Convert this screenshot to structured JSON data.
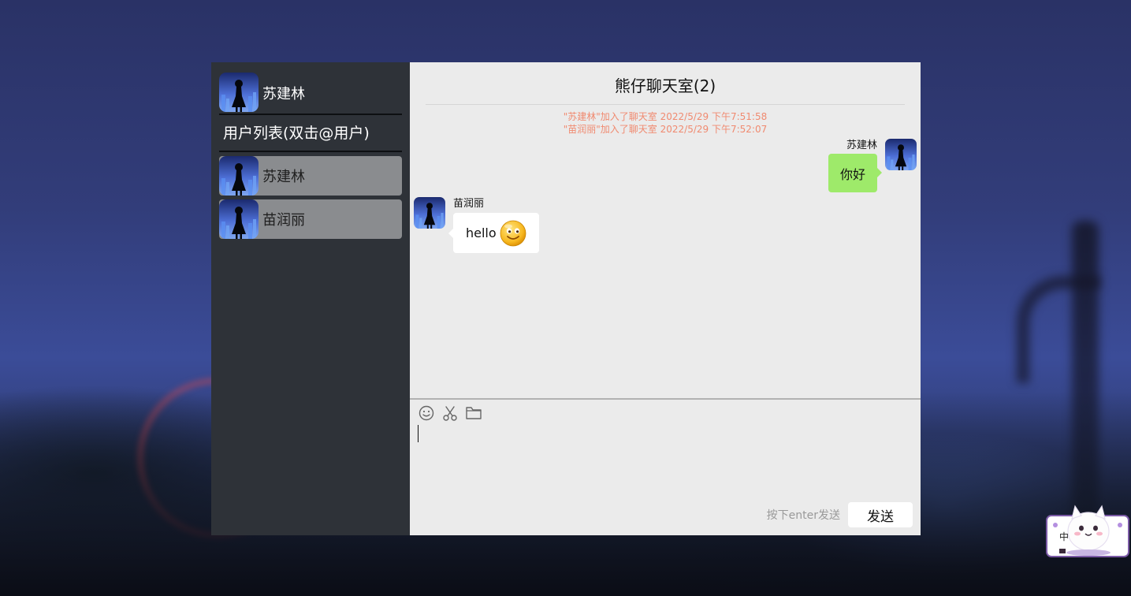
{
  "sidebar": {
    "current_user": {
      "name": "苏建林",
      "avatar_icon": "avatar-girl-silhouette-icon"
    },
    "list_title": "用户列表(双击@用户)",
    "users": [
      {
        "name": "苏建林",
        "avatar_icon": "avatar-girl-silhouette-icon"
      },
      {
        "name": "苗润丽",
        "avatar_icon": "avatar-girl-silhouette-icon"
      }
    ]
  },
  "chat": {
    "room_title": "熊仔聊天室(2)",
    "system_messages": [
      "\"苏建林\"加入了聊天室 2022/5/29 下午7:51:58",
      "\"苗润丽\"加入了聊天室 2022/5/29 下午7:52:07"
    ],
    "messages": [
      {
        "sender": "苏建林",
        "text": "你好",
        "side": "right",
        "bubble_color": "#9eea6a"
      },
      {
        "sender": "苗润丽",
        "text": "hello",
        "emoji": "smiley-face-icon",
        "side": "left",
        "bubble_color": "#ffffff"
      }
    ]
  },
  "composer": {
    "tools": [
      "smiley-icon",
      "scissors-icon",
      "folder-icon"
    ],
    "hint": "按下enter发送",
    "send_label": "发送"
  },
  "ime_indicator": {
    "label": "中"
  },
  "colors": {
    "sidebar_bg": "#2e3238",
    "chat_bg": "#ebebeb",
    "user_item_bg": "#8a8c8f",
    "system_text": "#f08a70",
    "my_bubble": "#9eea6a"
  }
}
